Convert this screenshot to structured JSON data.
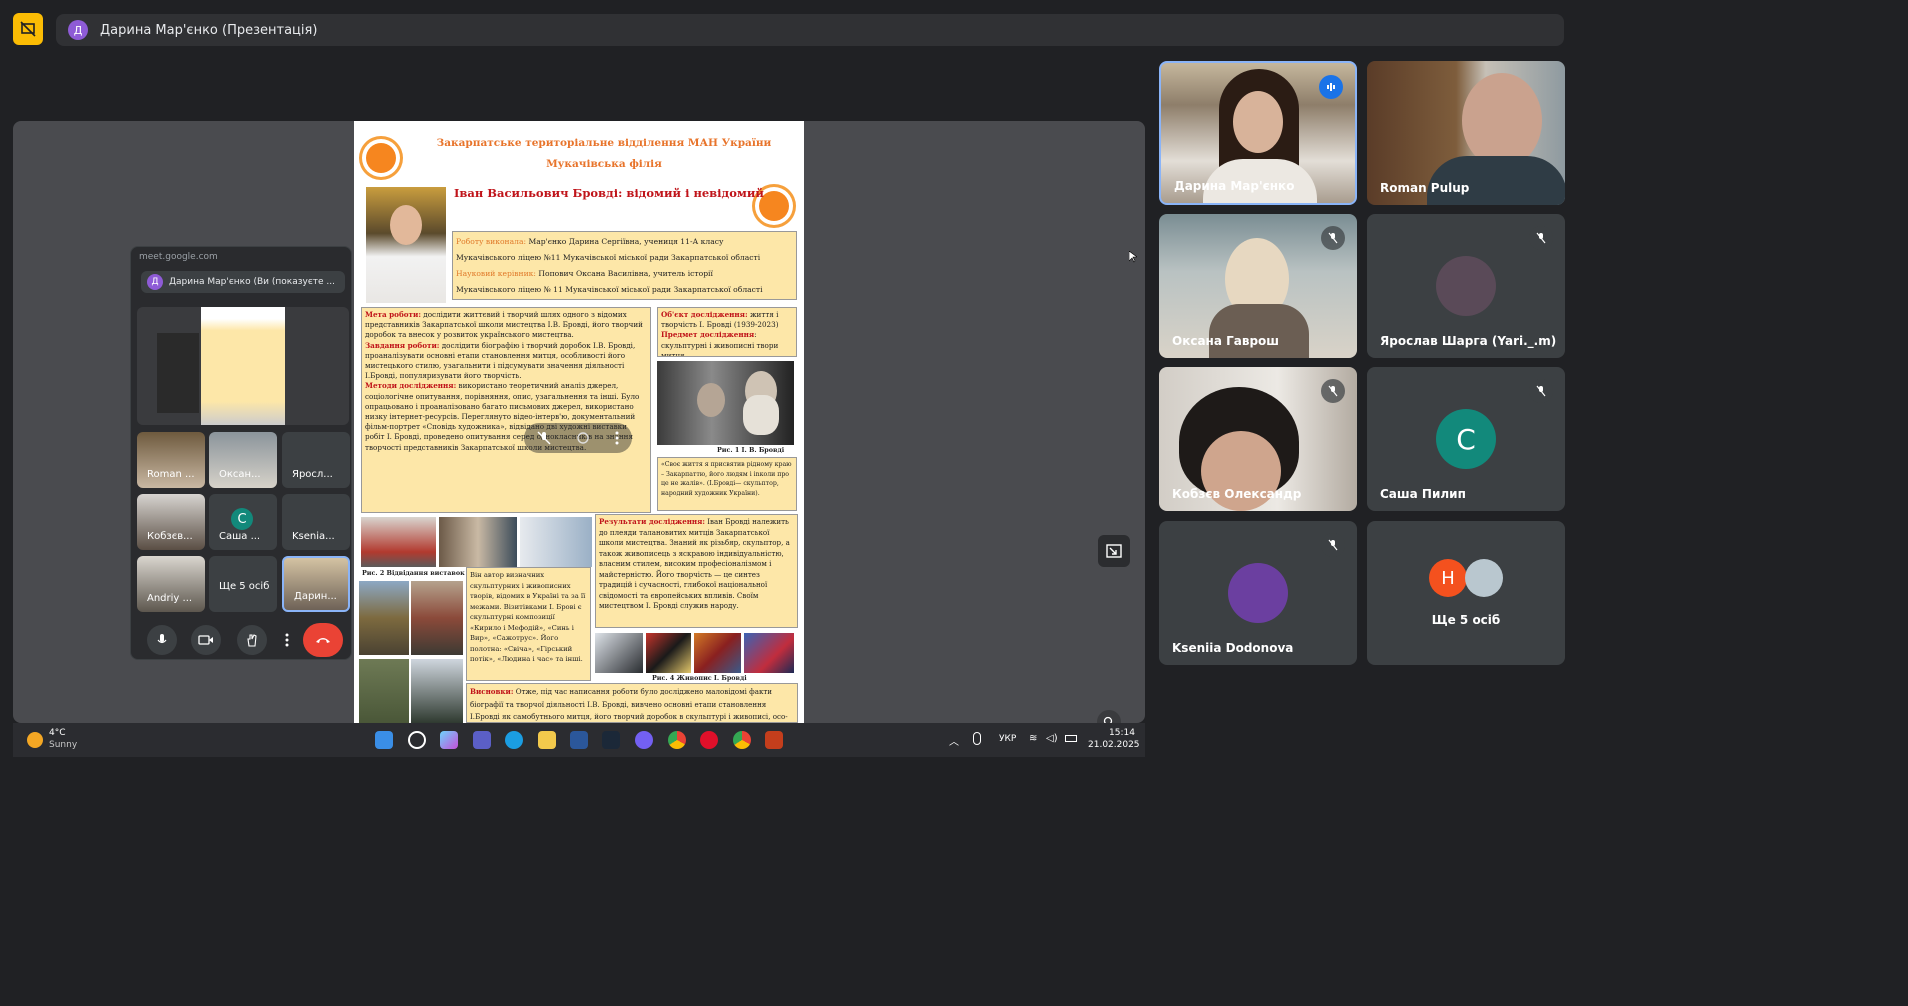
{
  "presenter_chip": {
    "initial": "Д",
    "label": "Дарина Мар'єнко (Презентація)"
  },
  "slide": {
    "org_line1": "Закарпатське територіальне відділення МАН України",
    "org_line2": "Мукачівська філія",
    "title": "Іван Васильович Бровді: відомий і невідомий",
    "authors": [
      {
        "label": "Роботу виконала:",
        "text": " Мар'єнко Дарина Сергіївна, учениця 11-А класу"
      },
      {
        "label": "",
        "text": "Мукачівського ліцею №11 Мукачівської міської ради Закарпатської області"
      },
      {
        "label": "Науковий керівник:",
        "text": " Попович Оксана Василівна, учитель історії"
      },
      {
        "label": "",
        "text": "Мукачівського ліцею № 11 Мукачівської міської ради Закарпатської області"
      }
    ],
    "aim_label": "Мета роботи:",
    "aim_text": " дослідити життєвий і творчий шлях одного з відомих представників Закарпатської школи мистецтва І.В. Бровді, його творчий доробок та внесок у розвиток українського мистецтва.",
    "tasks_label": "Завдання роботи:",
    "tasks_text": " дослідити біографію і творчий доробок І.В. Бровді, проаналізувати основні етапи становлення митця, особливості його мистецького стилю, узагальнити і підсумувати значення діяльності І.Бровді, популяризувати його творчість.",
    "methods_label": "Методи дослідження:",
    "methods_text": " використано теоретичний аналіз джерел, соціологічне опитування, порівняння, опис, узагальнення та інші. Було опрацьовано і проаналізовано багато письмових джерел, використано низку інтернет-ресурсів. Переглянуто відео-інтерв'ю, документальний фільм-портрет «Сповідь художника», відвідано дві художні виставки робіт І. Бровді, проведено опитування серед однокласників на знання творчості представників Закарпатської школи мистецтва.",
    "object_label": "Об'єкт дослідження:",
    "object_text": " життя і творчість І. Бровді (1939-2023)",
    "subject_label": "Предмет дослідження",
    "subject_text": ": скульптурні і живописні твори митця.",
    "fig1_caption": "Рис. 1  І. В. Бровді",
    "quote": "«Своє життя я присвятив рідному краю – Закарпаттю, його людям і inколи про це не жалів».  (І.Бровді— скульптор, народний художник України).",
    "fig2_caption": "Рис. 2 Відвідання виставок",
    "sculpt_text": "Він автор визначних скульптурних і живописних творів, відомих в Україні та за її межами. Візитівками І. Брові є скульптурні композиції «Кирило і Мефодій», «Синь і Вир», «Сажотрус». Його полотна: «Свіча», «Гірський потік», «Людина і час» та інші.",
    "results_label": "Результати дослідження:",
    "results_text": " Іван Бровді належить до плеяди талановитих митців Закарпатської школи мистецтва. Знаний як різьбяр, скульптор, а також живописець з яскравою індивідуальністю, власним стилем, високим професіоналізмом і майстерністю. Його творчість — це синтез традицій і сучасності, глибокої національної свідомості та європейських впливів. Своїм мистецтвом І. Бровді служив народу.",
    "fig4_caption": "Рис. 4  Живопис І. Бровді",
    "conclusions_label": "Висновки:",
    "conclusions_text": " Отже, під час написання роботи було досліджено маловідомі факти біографії та творчої діяльності І.В. Бровді, вивчено основні етапи становлення І.Бровді як самобутнього митця, його творчий доробок в скульптурі і живописі, осо-"
  },
  "mini_window": {
    "url": "meet.google.com",
    "chip_initial": "Д",
    "chip_text": "Дарина Мар'єнко (Ви (показуєте ...",
    "tiles": [
      "Roman ...",
      "Оксан...",
      "Яросл...",
      "Кобзєв...",
      "Саша ...",
      "Ksenia...",
      "Andriy ...",
      "Ще 5 осіб",
      "Дарин..."
    ],
    "sasha_initial": "С"
  },
  "taskbar": {
    "weather_temp": "4°C",
    "weather_desc": "Sunny",
    "lang": "УКР",
    "time": "15:14",
    "date": "21.02.2025"
  },
  "participants": [
    {
      "name": "Дарина Мар'єнко",
      "speaking": true
    },
    {
      "name": "Roman Pulup",
      "muted": false
    },
    {
      "name": "Оксана Гаврош",
      "muted": true
    },
    {
      "name": "Ярослав Шарга (Yari._.m)",
      "muted": true
    },
    {
      "name": "Кобзєв Олександр",
      "muted": true
    },
    {
      "name": "Саша Пилип",
      "initial": "С",
      "avatar_color": "#12897b",
      "muted": true
    },
    {
      "name": "Kseniia Dodonova",
      "muted": true
    },
    {
      "name": "Ще 5 осіб",
      "initial": "H",
      "avatar_color": "#f4511e"
    }
  ],
  "colors": {
    "background": "#202124",
    "tile": "#3c4043",
    "accent_yellow": "#fbbc04",
    "end_call": "#ea4335",
    "active_border": "#8ab4f8"
  }
}
